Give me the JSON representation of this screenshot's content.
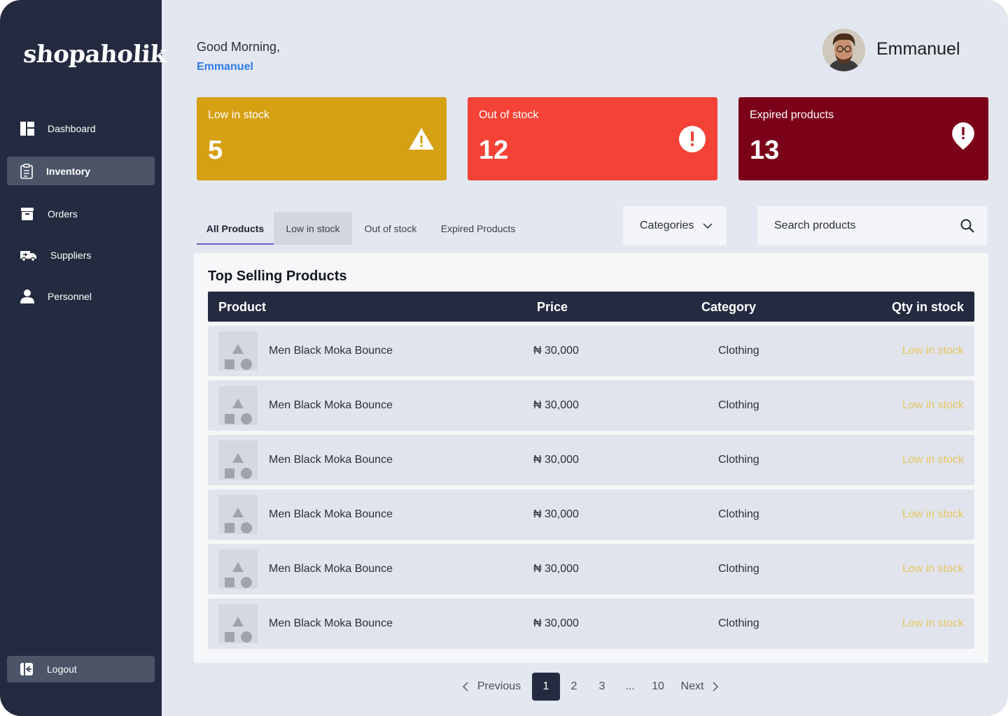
{
  "brand": {
    "logo_text": "shopaholik"
  },
  "sidebar": {
    "items": [
      {
        "label": "Dashboard",
        "icon": "dashboard-icon"
      },
      {
        "label": "Inventory",
        "icon": "clipboard-icon",
        "active": true
      },
      {
        "label": "Orders",
        "icon": "archive-box-icon"
      },
      {
        "label": "Suppliers",
        "icon": "delivery-truck-icon"
      },
      {
        "label": "Personnel",
        "icon": "user-icon"
      }
    ],
    "logout": {
      "label": "Logout",
      "icon": "logout-icon"
    }
  },
  "header": {
    "greeting": "Good Morning,",
    "greeting_name": "Emmanuel",
    "user_name": "Emmanuel"
  },
  "cards": [
    {
      "label": "Low in stock",
      "value": "5",
      "color": "#d6a013",
      "icon": "warning-triangle-icon"
    },
    {
      "label": "Out of stock",
      "value": "12",
      "color": "#f44336",
      "icon": "alert-circle-icon"
    },
    {
      "label": "Expired products",
      "value": "13",
      "color": "#7b0119",
      "icon": "alert-pin-icon"
    }
  ],
  "tabs": [
    {
      "label": "All Products",
      "active": true
    },
    {
      "label": "Low in stock"
    },
    {
      "label": "Out of stock"
    },
    {
      "label": "Expired Products"
    }
  ],
  "filters": {
    "categories_label": "Categories",
    "search_placeholder": "Search products"
  },
  "table": {
    "title": "Top Selling Products",
    "columns": [
      "Product",
      "Price",
      "Category",
      "Qty in stock"
    ],
    "rows": [
      {
        "product": "Men Black Moka Bounce",
        "price": "₦ 30,000",
        "category": "Clothing",
        "stock": "Low in stock"
      },
      {
        "product": "Men Black Moka Bounce",
        "price": "₦ 30,000",
        "category": "Clothing",
        "stock": "Low in stock"
      },
      {
        "product": "Men Black Moka Bounce",
        "price": "₦ 30,000",
        "category": "Clothing",
        "stock": "Low in stock"
      },
      {
        "product": "Men Black Moka Bounce",
        "price": "₦ 30,000",
        "category": "Clothing",
        "stock": "Low in stock"
      },
      {
        "product": "Men Black Moka Bounce",
        "price": "₦ 30,000",
        "category": "Clothing",
        "stock": "Low in stock"
      },
      {
        "product": "Men Black Moka Bounce",
        "price": "₦ 30,000",
        "category": "Clothing",
        "stock": "Low in stock"
      }
    ]
  },
  "pagination": {
    "previous": "Previous",
    "next": "Next",
    "pages": [
      "1",
      "2",
      "3",
      "...",
      "10"
    ],
    "current": "1"
  },
  "colors": {
    "sidebar": "#242b40",
    "accent_blue": "#2f7be8",
    "tab_underline": "#6d5bd0",
    "status_low": "#e7c661"
  }
}
